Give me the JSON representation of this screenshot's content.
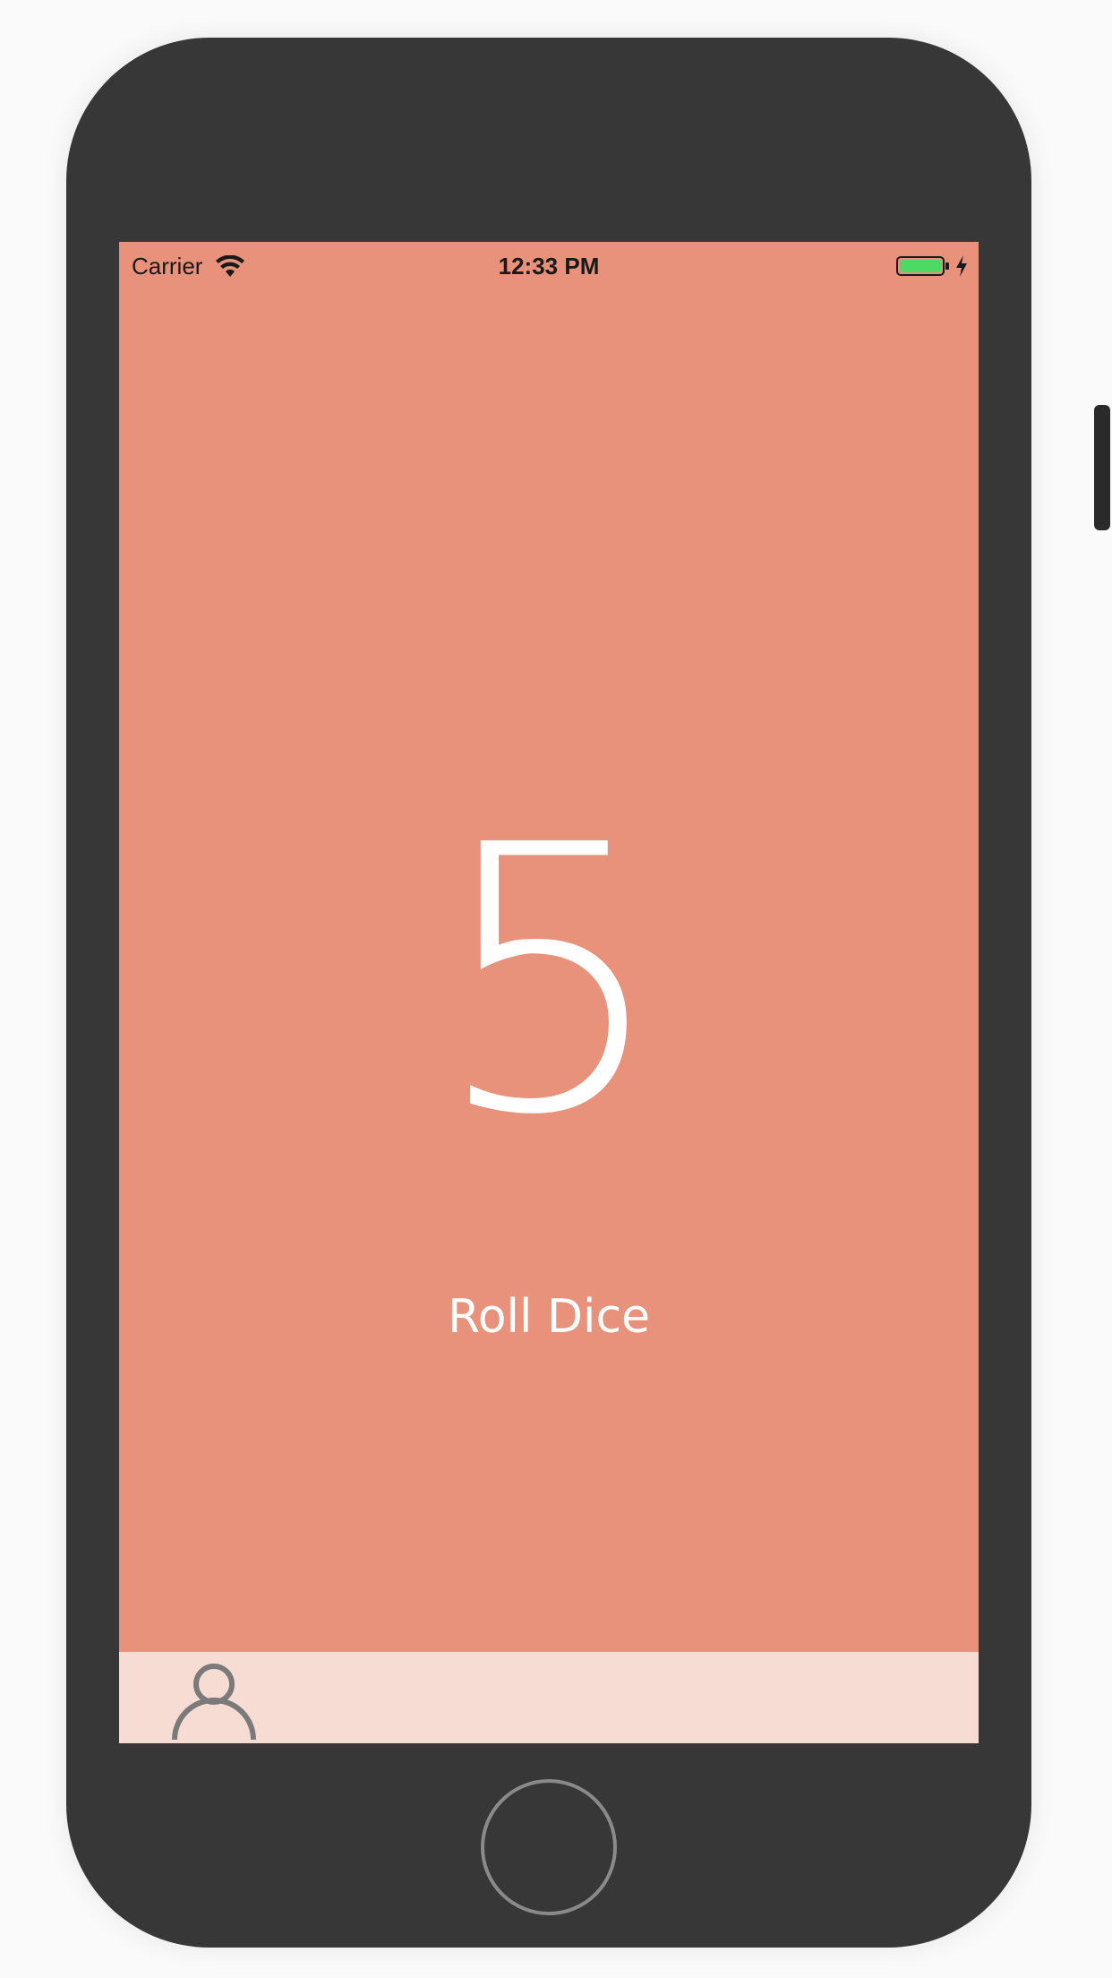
{
  "status_bar": {
    "carrier": "Carrier",
    "time": "12:33 PM",
    "wifi_icon": "wifi-icon",
    "battery_icon": "battery-icon",
    "battery_level": 1.0,
    "charging_icon": "bolt-icon",
    "battery_color": "#4cd964"
  },
  "main": {
    "dice_value": "5",
    "roll_button_label": "Roll Dice",
    "background_color": "#e8927b",
    "text_color": "#ffffff"
  },
  "tab_bar": {
    "background_color": "#f7dcd3",
    "items": [
      {
        "icon": "person-icon",
        "name": "profile"
      }
    ]
  },
  "device": {
    "frame_color": "#373737",
    "home_button": "home-button"
  }
}
